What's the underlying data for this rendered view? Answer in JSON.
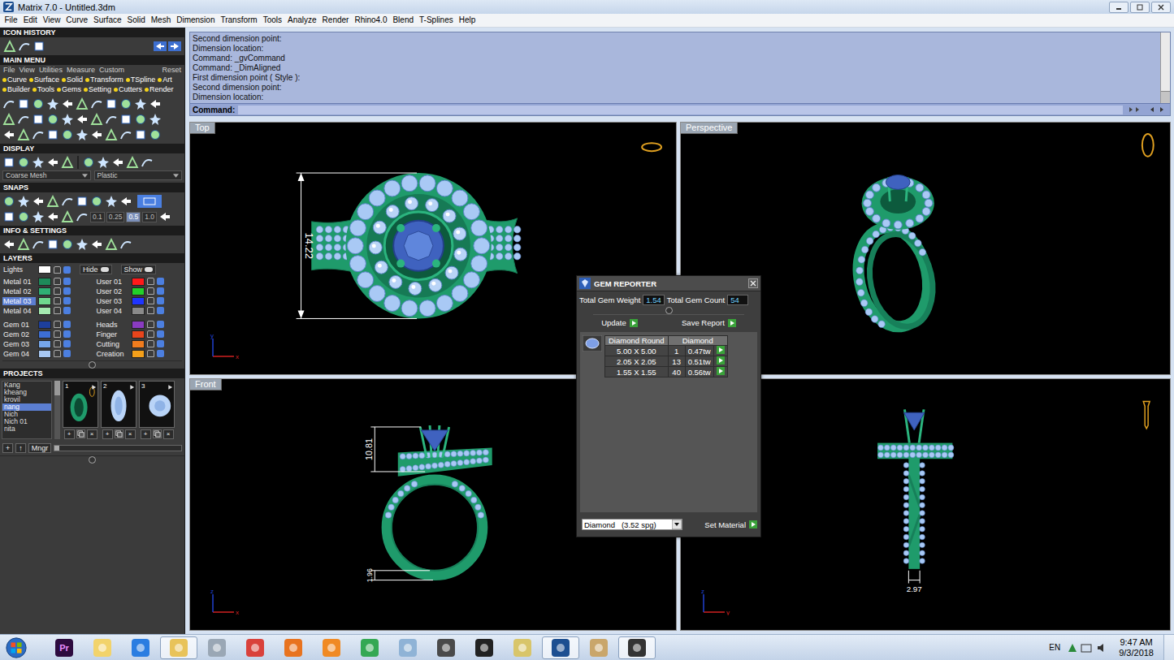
{
  "window": {
    "title": "Matrix 7.0 - Untitled.3dm"
  },
  "menubar": [
    "File",
    "Edit",
    "View",
    "Curve",
    "Surface",
    "Solid",
    "Mesh",
    "Dimension",
    "Transform",
    "Tools",
    "Analyze",
    "Render",
    "Rhino4.0",
    "Blend",
    "T-Splines",
    "Help"
  ],
  "sidebar": {
    "icon_history": {
      "title": "ICON HISTORY"
    },
    "main_menu": {
      "title": "MAIN MENU",
      "tabs": [
        "File",
        "View",
        "Utilities",
        "Measure",
        "Custom"
      ],
      "reset": "Reset",
      "categories": [
        [
          "Curve",
          "Surface",
          "Solid",
          "Transform",
          "TSpline",
          "Art"
        ],
        [
          "Builder",
          "Tools",
          "Gems",
          "Setting",
          "Cutters",
          "Render"
        ]
      ]
    },
    "display": {
      "title": "DISPLAY",
      "mesh": "Coarse Mesh",
      "material": "Plastic"
    },
    "snaps": {
      "title": "SNAPS",
      "steps": [
        {
          "label": "0.1",
          "selected": false
        },
        {
          "label": "0.25",
          "selected": false
        },
        {
          "label": "0.5",
          "selected": true
        },
        {
          "label": "1.0",
          "selected": false
        }
      ]
    },
    "info": {
      "title": "INFO & SETTINGS"
    },
    "layers": {
      "title": "LAYERS",
      "lights": {
        "name": "Lights",
        "color": "#ffffff"
      },
      "hide": "Hide",
      "show": "Show",
      "blocks": [
        [
          {
            "name": "Metal 01",
            "color": "#1e8a5a",
            "selected": false
          },
          {
            "name": "Metal 02",
            "color": "#2fb074",
            "selected": false
          },
          {
            "name": "Metal 03",
            "color": "#6fd98e",
            "selected": true
          },
          {
            "name": "Metal 04",
            "color": "#a5eab0",
            "selected": false
          }
        ],
        [
          {
            "name": "User 01",
            "color": "#ff1a1a",
            "selected": false
          },
          {
            "name": "User 02",
            "color": "#22d12a",
            "selected": false
          },
          {
            "name": "User 03",
            "color": "#1f35ff",
            "selected": false
          },
          {
            "name": "User 04",
            "color": "#8a8a8a",
            "selected": false
          }
        ],
        [
          {
            "name": "Gem 01",
            "color": "#1d3f9c",
            "selected": false
          },
          {
            "name": "Gem 02",
            "color": "#3d6ed3",
            "selected": false
          },
          {
            "name": "Gem 03",
            "color": "#76a6ea",
            "selected": false
          },
          {
            "name": "Gem 04",
            "color": "#a8c8f2",
            "selected": false
          }
        ],
        [
          {
            "name": "Heads",
            "color": "#8a3bc0",
            "selected": false
          },
          {
            "name": "Finger",
            "color": "#e8451c",
            "selected": false
          },
          {
            "name": "Cutting",
            "color": "#f07c1e",
            "selected": false
          },
          {
            "name": "Creation",
            "color": "#f5a01a",
            "selected": false
          }
        ]
      ]
    },
    "projects": {
      "title": "PROJECTS",
      "items": [
        {
          "name": "Kang",
          "selected": false
        },
        {
          "name": "kheang",
          "selected": false
        },
        {
          "name": "krovil",
          "selected": false
        },
        {
          "name": "nang",
          "selected": true
        },
        {
          "name": "Nich",
          "selected": false
        },
        {
          "name": "Nich 01",
          "selected": false
        },
        {
          "name": "nita",
          "selected": false
        }
      ],
      "thumbnails": [
        "1",
        "2",
        "3"
      ],
      "thumb_actions": [
        "+",
        "×"
      ],
      "buttons": [
        "+",
        "↑",
        "Mngr"
      ]
    }
  },
  "command": {
    "log": [
      "Second dimension point:",
      "Dimension location:",
      "Command: _gvCommand",
      "Command: _DimAligned",
      "First dimension point ( Style ):",
      "Second dimension point:",
      "Dimension location:"
    ],
    "prompt": "Command:"
  },
  "viewports": [
    {
      "label": "Top",
      "kind": "top",
      "dimensions": [
        "14.22"
      ],
      "axes": {
        "h": "x",
        "v": "y"
      }
    },
    {
      "label": "Perspective",
      "kind": "perspective",
      "dimensions": [],
      "axes": null
    },
    {
      "label": "Front",
      "kind": "front",
      "dimensions": [
        "10.81",
        "1.96"
      ],
      "axes": {
        "h": "x",
        "v": "z"
      }
    },
    {
      "label": "",
      "kind": "right",
      "dimensions": [
        "2.97"
      ],
      "axes": {
        "h": "y",
        "v": "z"
      }
    }
  ],
  "gem_reporter": {
    "title": "GEM REPORTER",
    "weight_label": "Total Gem Weight",
    "weight": "1.54",
    "count_label": "Total Gem Count",
    "count": "54",
    "update": "Update",
    "save": "Save Report",
    "columns": [
      "Diamond Round",
      "Diamond"
    ],
    "rows": [
      {
        "size": "5.00 X 5.00",
        "count": "1",
        "weight": "0.47tw"
      },
      {
        "size": "2.05 X 2.05",
        "count": "13",
        "weight": "0.51tw"
      },
      {
        "size": "1.55 X 1.55",
        "count": "40",
        "weight": "0.56tw"
      }
    ],
    "material": "Diamond   (3.52 spg)",
    "set_material": "Set Material"
  },
  "taskbar": {
    "apps": [
      {
        "label": "Pr",
        "color": "#2d0b3f",
        "active": false
      },
      {
        "label": "",
        "color": "#f2d36b",
        "active": false
      },
      {
        "label": "",
        "color": "#2a7de1",
        "active": false
      },
      {
        "label": "",
        "color": "#e8c35a",
        "active": true
      },
      {
        "label": "",
        "color": "#9aa7b5",
        "active": false
      },
      {
        "label": "",
        "color": "#d9413b",
        "active": false
      },
      {
        "label": "",
        "color": "#e8731f",
        "active": false
      },
      {
        "label": "",
        "color": "#f08a24",
        "active": false
      },
      {
        "label": "",
        "color": "#34a853",
        "active": false
      },
      {
        "label": "",
        "color": "#8fb3d6",
        "active": false
      },
      {
        "label": "",
        "color": "#4a4a4a",
        "active": false
      },
      {
        "label": "",
        "color": "#222222",
        "active": false
      },
      {
        "label": "",
        "color": "#d8c56a",
        "active": false
      },
      {
        "label": "",
        "color": "#1d4f91",
        "active": true
      },
      {
        "label": "",
        "color": "#c9a66b",
        "active": false
      },
      {
        "label": "",
        "color": "#333333",
        "active": true
      }
    ],
    "language": "EN",
    "time": "9:47 AM",
    "date": "9/3/2018"
  }
}
